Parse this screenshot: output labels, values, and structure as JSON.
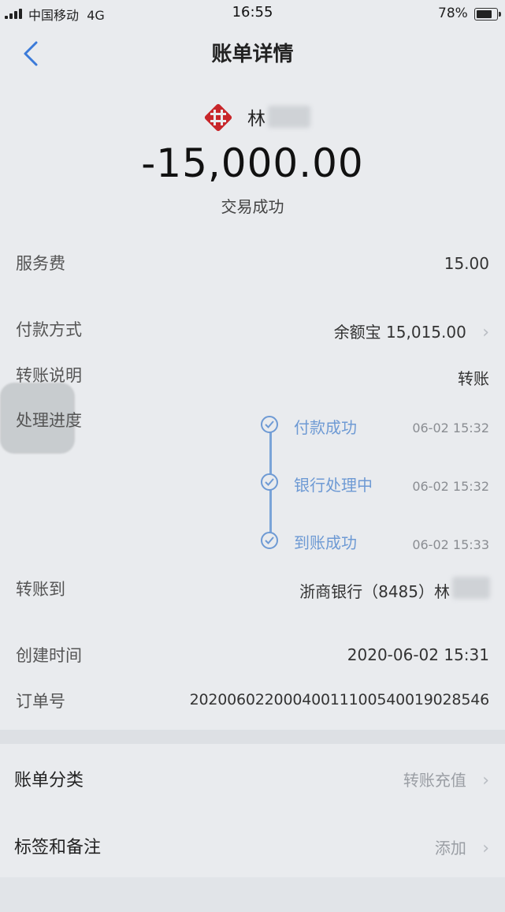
{
  "status_bar": {
    "carrier": "中国移动",
    "network": "4G",
    "time": "16:55",
    "battery": "78%",
    "battery_level": 0.78
  },
  "nav": {
    "title": "账单详情",
    "back_icon": "chevron-left-icon"
  },
  "header": {
    "payee": "林",
    "amount": "-15,000.00",
    "status": "交易成功",
    "logo_icon": "bank-logo-icon",
    "brand_color": "#c8262a"
  },
  "details": {
    "service_fee": {
      "label": "服务费",
      "value": "15.00"
    },
    "payment_method": {
      "label": "付款方式",
      "value": "余额宝 15,015.00"
    },
    "transfer_note": {
      "label": "转账说明",
      "value": "转账"
    },
    "progress": {
      "label": "处理进度",
      "steps": [
        {
          "name": "付款成功",
          "time": "06-02 15:32"
        },
        {
          "name": "银行处理中",
          "time": "06-02 15:32"
        },
        {
          "name": "到账成功",
          "time": "06-02 15:33"
        }
      ],
      "accent_color": "#6e9ad4"
    },
    "transfer_to": {
      "label": "转账到",
      "value": "浙商银行（8485）林"
    },
    "created_time": {
      "label": "创建时间",
      "value": "2020-06-02 15:31"
    },
    "order_no": {
      "label": "订单号",
      "value": "20200602200040011100540019028546"
    }
  },
  "sections": {
    "category": {
      "label": "账单分类",
      "value": "转账充值"
    },
    "tags": {
      "label": "标签和备注",
      "value": "添加"
    }
  }
}
